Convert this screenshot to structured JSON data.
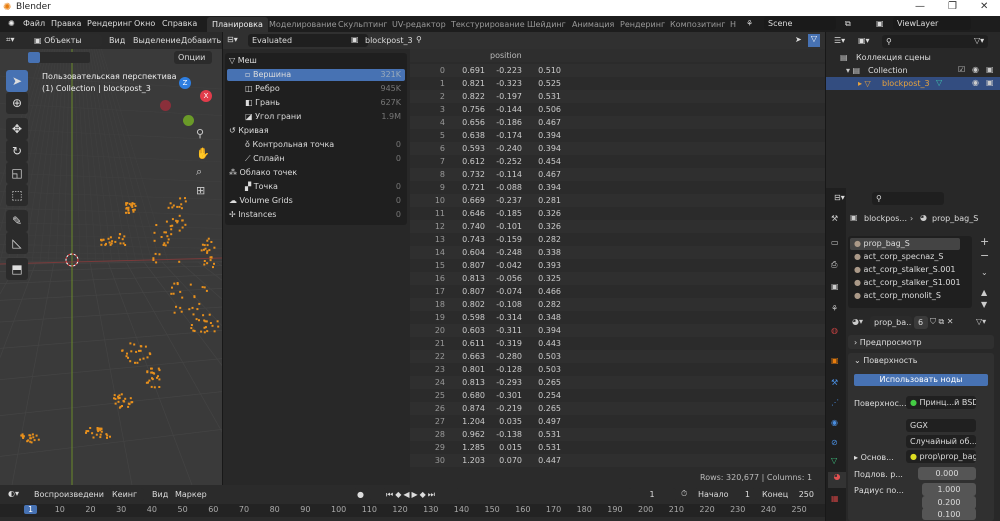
{
  "window": {
    "title": "Blender"
  },
  "menu": [
    "Файл",
    "Правка",
    "Рендеринг",
    "Окно",
    "Справка"
  ],
  "workspaces": [
    "Планировка",
    "Моделирование",
    "Скульптинг",
    "UV-редактор",
    "Текстурирование",
    "Шейдинг",
    "Анимация",
    "Рендеринг",
    "Композитинг",
    "Н"
  ],
  "scene": "Scene",
  "view_layer": "ViewLayer",
  "viewport": {
    "mode": "Объекты",
    "menus": [
      "Вид",
      "Выделение",
      "Добавить"
    ],
    "options": "Опции",
    "perspective": "Пользовательская перспектива",
    "collection_info": "(1) Collection | blockpost_3",
    "axes": [
      "Z",
      "X"
    ]
  },
  "spreadsheet": {
    "eval": "Evaluated",
    "object": "blockpost_3",
    "tree": [
      {
        "label": "Меш",
        "count": "",
        "level": 0
      },
      {
        "label": "Вершина",
        "count": "321K",
        "level": 1,
        "selected": true
      },
      {
        "label": "Ребро",
        "count": "945K",
        "level": 1
      },
      {
        "label": "Грань",
        "count": "627K",
        "level": 1
      },
      {
        "label": "Угол грани",
        "count": "1.9M",
        "level": 1
      },
      {
        "label": "Кривая",
        "count": "",
        "level": 0
      },
      {
        "label": "Контрольная точка",
        "count": "0",
        "level": 1
      },
      {
        "label": "Сплайн",
        "count": "0",
        "level": 1
      },
      {
        "label": "Облако точек",
        "count": "",
        "level": 0
      },
      {
        "label": "Точка",
        "count": "0",
        "level": 1
      },
      {
        "label": "Volume Grids",
        "count": "0",
        "level": 0
      },
      {
        "label": "Instances",
        "count": "0",
        "level": 0
      }
    ],
    "column": "position",
    "rows": [
      [
        "0",
        "0.691",
        "-0.223",
        "0.510"
      ],
      [
        "1",
        "0.821",
        "-0.323",
        "0.525"
      ],
      [
        "2",
        "0.822",
        "-0.197",
        "0.531"
      ],
      [
        "3",
        "0.756",
        "-0.144",
        "0.506"
      ],
      [
        "4",
        "0.656",
        "-0.186",
        "0.467"
      ],
      [
        "5",
        "0.638",
        "-0.174",
        "0.394"
      ],
      [
        "6",
        "0.593",
        "-0.240",
        "0.394"
      ],
      [
        "7",
        "0.612",
        "-0.252",
        "0.454"
      ],
      [
        "8",
        "0.732",
        "-0.114",
        "0.467"
      ],
      [
        "9",
        "0.721",
        "-0.088",
        "0.394"
      ],
      [
        "10",
        "0.669",
        "-0.237",
        "0.281"
      ],
      [
        "11",
        "0.646",
        "-0.185",
        "0.326"
      ],
      [
        "12",
        "0.740",
        "-0.101",
        "0.326"
      ],
      [
        "13",
        "0.743",
        "-0.159",
        "0.282"
      ],
      [
        "14",
        "0.604",
        "-0.248",
        "0.338"
      ],
      [
        "15",
        "0.807",
        "-0.042",
        "0.393"
      ],
      [
        "16",
        "0.813",
        "-0.056",
        "0.325"
      ],
      [
        "17",
        "0.807",
        "-0.074",
        "0.466"
      ],
      [
        "18",
        "0.802",
        "-0.108",
        "0.282"
      ],
      [
        "19",
        "0.598",
        "-0.314",
        "0.348"
      ],
      [
        "20",
        "0.603",
        "-0.311",
        "0.394"
      ],
      [
        "21",
        "0.611",
        "-0.319",
        "0.443"
      ],
      [
        "22",
        "0.663",
        "-0.280",
        "0.503"
      ],
      [
        "23",
        "0.801",
        "-0.128",
        "0.503"
      ],
      [
        "24",
        "0.813",
        "-0.293",
        "0.265"
      ],
      [
        "25",
        "0.680",
        "-0.301",
        "0.254"
      ],
      [
        "26",
        "0.874",
        "-0.219",
        "0.265"
      ],
      [
        "27",
        "1.204",
        "0.035",
        "0.497"
      ],
      [
        "28",
        "0.962",
        "-0.138",
        "0.531"
      ],
      [
        "29",
        "1.285",
        "0.015",
        "0.531"
      ],
      [
        "30",
        "1.203",
        "0.070",
        "0.447"
      ]
    ],
    "status": "Rows: 320,677   |   Columns: 1"
  },
  "outliner": {
    "scene_collection": "Коллекция сцены",
    "collection": "Collection",
    "object": "blockpost_3"
  },
  "properties": {
    "breadcrumb_object": "blockpos...",
    "breadcrumb_material": "prop_bag_S",
    "materials": [
      "prop_bag_S",
      "act_corp_specnaz_S",
      "act_corp_stalker_S.001",
      "act_corp_stalker_S1.001",
      "act_corp_monolit_S"
    ],
    "material_name": "prop_ba...",
    "users": "6",
    "preview": "Предпросмотр",
    "surface_panel": "Поверхность",
    "use_nodes": "Использовать ноды",
    "surface_label": "Поверхнос...",
    "surface_value": "Принц...й BSDF",
    "distribution": "GGX",
    "subsurface_method": "Случайный об...",
    "base_label": "Основ...",
    "base_value": "prop\\prop_bag",
    "subsurface_label": "Подлов. р...",
    "subsurface_value": "0.000",
    "radius_label": "Радиус по...",
    "radius_values": [
      "1.000",
      "0.200",
      "0.100"
    ]
  },
  "timeline": {
    "menus": [
      "Воспроизведение",
      "Кеинг",
      "Вид",
      "Маркер"
    ],
    "current_frame": "1",
    "start_label": "Начало",
    "start": "1",
    "end_label": "Конец",
    "end": "250",
    "ticks": [
      "1",
      "10",
      "20",
      "30",
      "40",
      "50",
      "60",
      "70",
      "80",
      "90",
      "100",
      "110",
      "120",
      "130",
      "140",
      "150",
      "160",
      "170",
      "180",
      "190",
      "200",
      "210",
      "220",
      "230",
      "240",
      "250"
    ]
  },
  "colors": {
    "accent": "#4772b3",
    "object": "#e8a33d",
    "selection": "#e87d0d"
  }
}
